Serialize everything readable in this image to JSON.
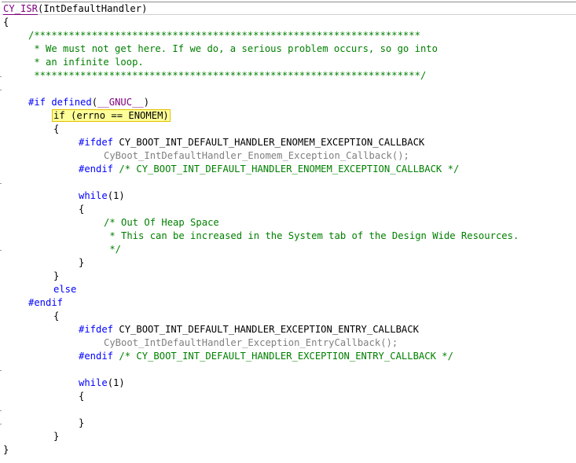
{
  "colors": {
    "keyword": "#0000ff",
    "macro": "#7f007f",
    "comment": "#008000",
    "function": "#808080",
    "highlight": "#ffff99"
  },
  "code": {
    "l1_macro": "CY_ISR",
    "l1_rest": "(IntDefaultHandler)",
    "l2": "{",
    "c1": "/*******************************************************************",
    "c2": " * We must not get here. If we do, a serious problem occurs, so go into",
    "c3": " * an infinite loop.",
    "c4": " *******************************************************************/",
    "if_directive": "#if defined",
    "if_open": "(",
    "gnuc": "__GNUC__",
    "if_close": ")",
    "if_stmt": "if (errno == ENOMEM)",
    "brace_open": "{",
    "brace_close": "}",
    "ifdef": "#ifdef",
    "enomem_cb_macro": "CY_BOOT_INT_DEFAULT_HANDLER_ENOMEM_EXCEPTION_CALLBACK",
    "enomem_cb_call": "CyBoot_IntDefaultHandler_Enomem_Exception_Callback();",
    "endif": "#endif",
    "enomem_endif_comment": "/* CY_BOOT_INT_DEFAULT_HANDLER_ENOMEM_EXCEPTION_CALLBACK */",
    "while_kw": "while",
    "while_rest": "(1)",
    "heap1": "/* Out Of Heap Space",
    "heap2": " * This can be increased in the System tab of the Design Wide Resources.",
    "heap3": " */",
    "else_kw": "else",
    "endif_top": "#endif",
    "entry_cb_macro": "CY_BOOT_INT_DEFAULT_HANDLER_EXCEPTION_ENTRY_CALLBACK",
    "entry_cb_call": "CyBoot_IntDefaultHandler_Exception_EntryCallback();",
    "entry_endif_comment": "/* CY_BOOT_INT_DEFAULT_HANDLER_EXCEPTION_ENTRY_CALLBACK */"
  }
}
